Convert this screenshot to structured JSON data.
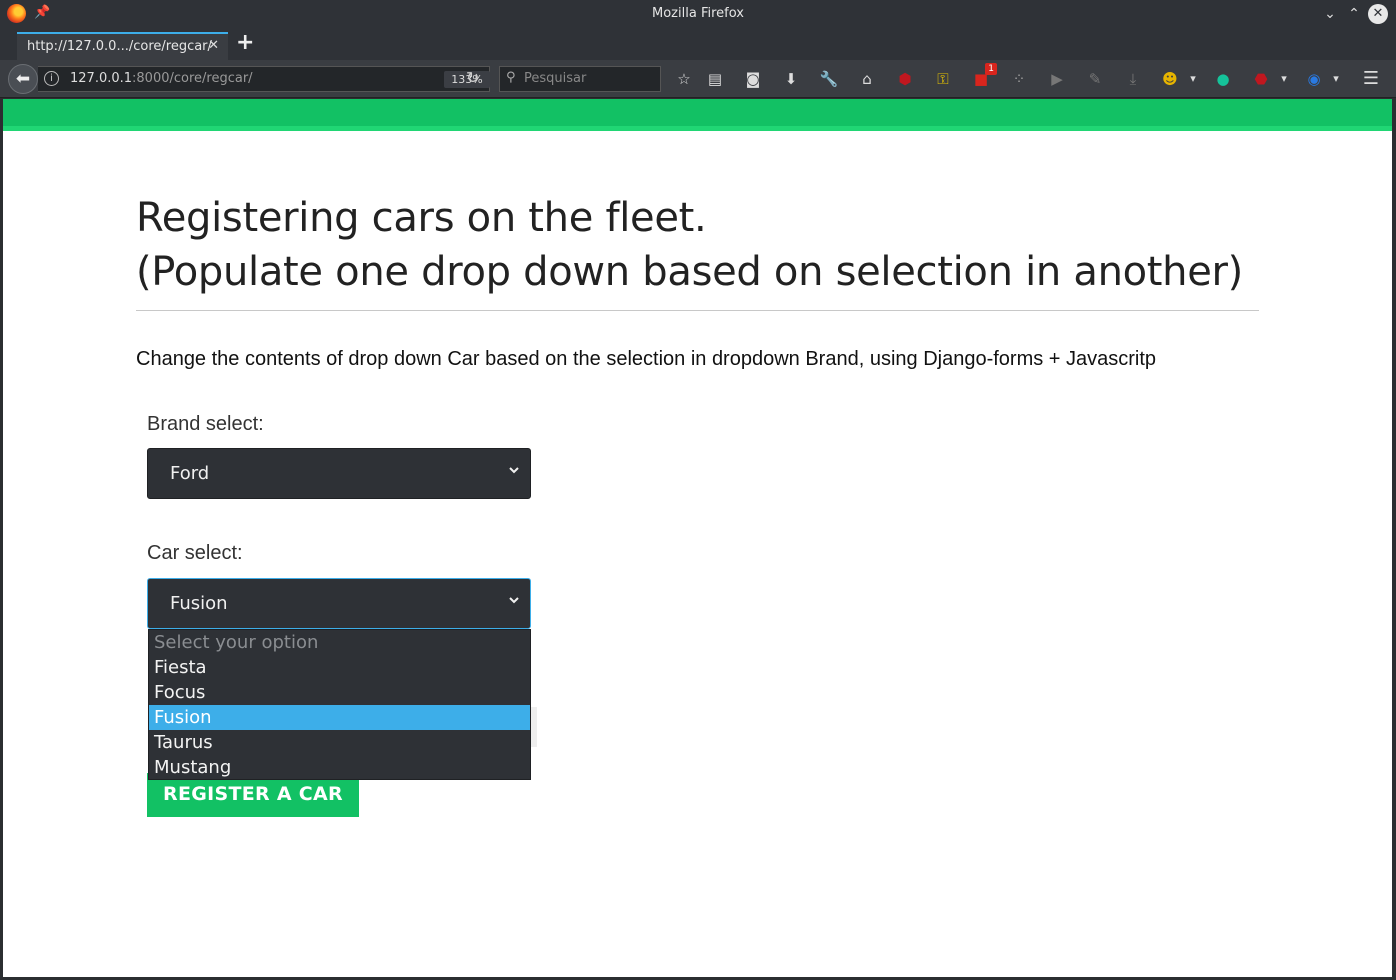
{
  "window": {
    "title": "Mozilla Firefox"
  },
  "tab": {
    "label": "http://127.0.0.../core/regcar/",
    "close": "✕",
    "new_tab": "+"
  },
  "nav": {
    "back": "⬅",
    "url_host": "127.0.0.1",
    "url_rest": ":8000/core/regcar/",
    "zoom": "133%",
    "reload": "↻",
    "search_placeholder": "Pesquisar",
    "badge_count": "1"
  },
  "page": {
    "heading_line1": "Registering cars on the fleet.",
    "heading_line2": "(Populate one drop down based on selection in another)",
    "lead": "Change the contents of drop down Car based on the selection in dropdown Brand, using Django-forms + Javascritp",
    "brand_label": "Brand select:",
    "brand_value": "Ford",
    "car_label": "Car select:",
    "car_value": "Fusion",
    "car_options": [
      "Select your option",
      "Fiesta",
      "Focus",
      "Fusion",
      "Taurus",
      "Mustang"
    ],
    "submit_label": "REGISTER A CAR"
  },
  "colors": {
    "accent_green": "#12c164",
    "highlight_blue": "#3daee9",
    "select_bg": "#2e3136"
  }
}
